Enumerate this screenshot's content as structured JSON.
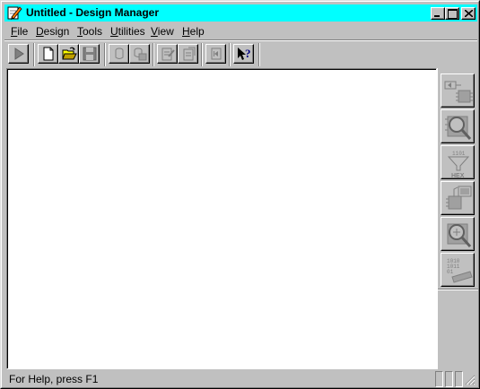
{
  "window": {
    "title": "Untitled - Design Manager",
    "app_icon": "pencil-icon",
    "controls": [
      "minimize-icon",
      "maximize-icon",
      "close-icon"
    ]
  },
  "menu": {
    "items": [
      {
        "label_ul": "F",
        "label_rest": "ile"
      },
      {
        "label_ul": "D",
        "label_rest": "esign"
      },
      {
        "label_ul": "T",
        "label_rest": "ools"
      },
      {
        "label_ul": "U",
        "label_rest": "tilities"
      },
      {
        "label_ul": "V",
        "label_rest": "iew"
      },
      {
        "label_ul": "H",
        "label_rest": "elp"
      }
    ]
  },
  "toolbar": {
    "buttons": [
      "run-icon",
      "new-file-icon",
      "open-folder-icon",
      "save-icon",
      "cylinder-icon",
      "cylinder-stack-icon",
      "document-edit-icon",
      "document-copy-icon",
      "rewind-icon",
      "context-help-icon"
    ]
  },
  "side_tools": {
    "buttons": [
      "design-entry-icon",
      "simulation-icon",
      "hex-filter-icon",
      "chip-monitor-icon",
      "chip-inspect-icon",
      "binary-program-icon"
    ]
  },
  "status": {
    "text": "For Help, press F1"
  },
  "colors": {
    "titlebar": "#00ffff",
    "face": "#c0c0c0",
    "client": "#ffffff"
  }
}
